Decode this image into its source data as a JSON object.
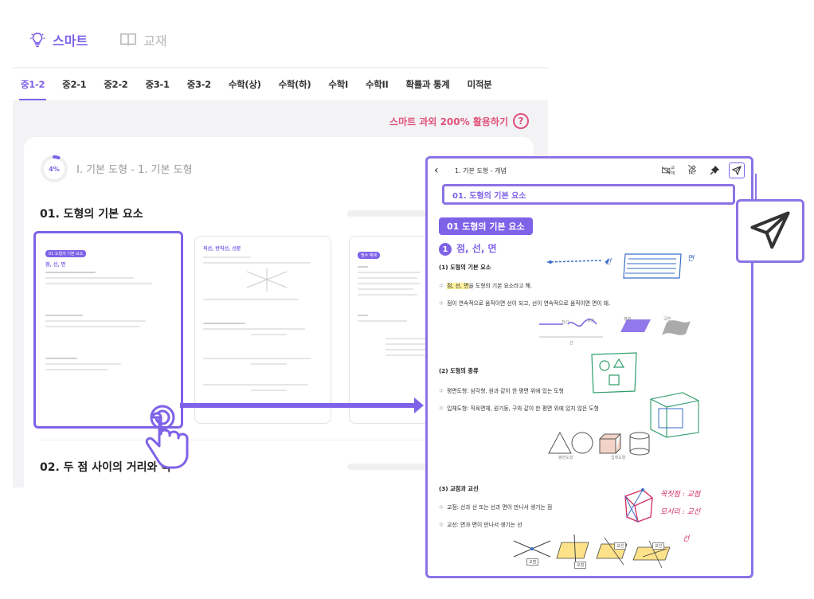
{
  "top_tabs": [
    {
      "label": "스마트",
      "icon": "lightbulb-icon",
      "active": true
    },
    {
      "label": "교재",
      "icon": "book-icon",
      "active": false
    }
  ],
  "grade_tabs": [
    "중1-2",
    "중2-1",
    "중2-2",
    "중3-1",
    "중3-2",
    "수학(상)",
    "수학(하)",
    "수학I",
    "수학II",
    "확률과 통계",
    "미적분"
  ],
  "help": {
    "label": "스마트 과외 200% 활용하기",
    "icon": "question-circle-icon"
  },
  "card": {
    "progress": "4%",
    "progress_value": 4,
    "unit_title": "I. 기본 도형 - 1. 기본 도형",
    "section1": "01. 도형의 기본 요소",
    "section2": "02. 두 점 사이의 거리와 각"
  },
  "thumbs": [
    {
      "pill": "01 도형의 기본 요소",
      "sub": "점, 선, 면"
    },
    {
      "pill": "",
      "sub": "직선, 반직선, 선분"
    },
    {
      "pill": "필수 예제",
      "sub": ""
    }
  ],
  "panel": {
    "breadcrumb": "1. 기본 도형 - 개념",
    "tools": [
      {
        "icon": "video-off-icon",
        "label": "교재"
      },
      {
        "icon": "pen-off-icon",
        "label": "PKT"
      },
      {
        "icon": "pin-icon",
        "label": ""
      },
      {
        "icon": "send-icon",
        "label": ""
      }
    ],
    "title": "01. 도형의 기본 요소",
    "doc_pill": "01 도형의 기본 요소",
    "badge": "1",
    "sub_title": "점, 선, 면",
    "lines": {
      "h1": "(1) 도형의 기본 요소",
      "p1_num": "①",
      "p1_pre": "점, 선, 면",
      "p1_post": "을 도형의 기본 요소라고 해.",
      "p2_num": "②",
      "p2": "점이 연속적으로 움직이면 선이 되고, 선이 연속적으로 움직이면 면이 돼.",
      "h2": "(2) 도형의 종류",
      "p3_num": "①",
      "p3": "평면도형: 삼각형, 원과 같이 한 평면 위에 있는 도형",
      "p4_num": "②",
      "p4": "입체도형: 직육면체, 원기둥, 구와 같이 한 평면 위에 있지 않은 도형",
      "h3": "(3) 교점과 교선",
      "p5_num": "①",
      "p5": "교점: 선과 선 또는 선과 면이 만나서 생기는 점",
      "p6_num": "②",
      "p6": "교선: 면과 면이 만나서 생기는 선"
    },
    "fig1": [
      "직선",
      "곡선",
      "평면",
      "곡면"
    ],
    "fig1_center": "선",
    "fig2": [
      "평면도형",
      "입체도형"
    ],
    "fig3": [
      "교점",
      "교점",
      "교선",
      "교선"
    ],
    "notes": {
      "n1": "꼭짓점 : 교점",
      "n2": "모서리 : 교선",
      "n3": "면",
      "n4": "선"
    }
  },
  "colors": {
    "accent": "#7e62e8",
    "pink": "#e0527a",
    "handwriting": "#d22a5e"
  }
}
